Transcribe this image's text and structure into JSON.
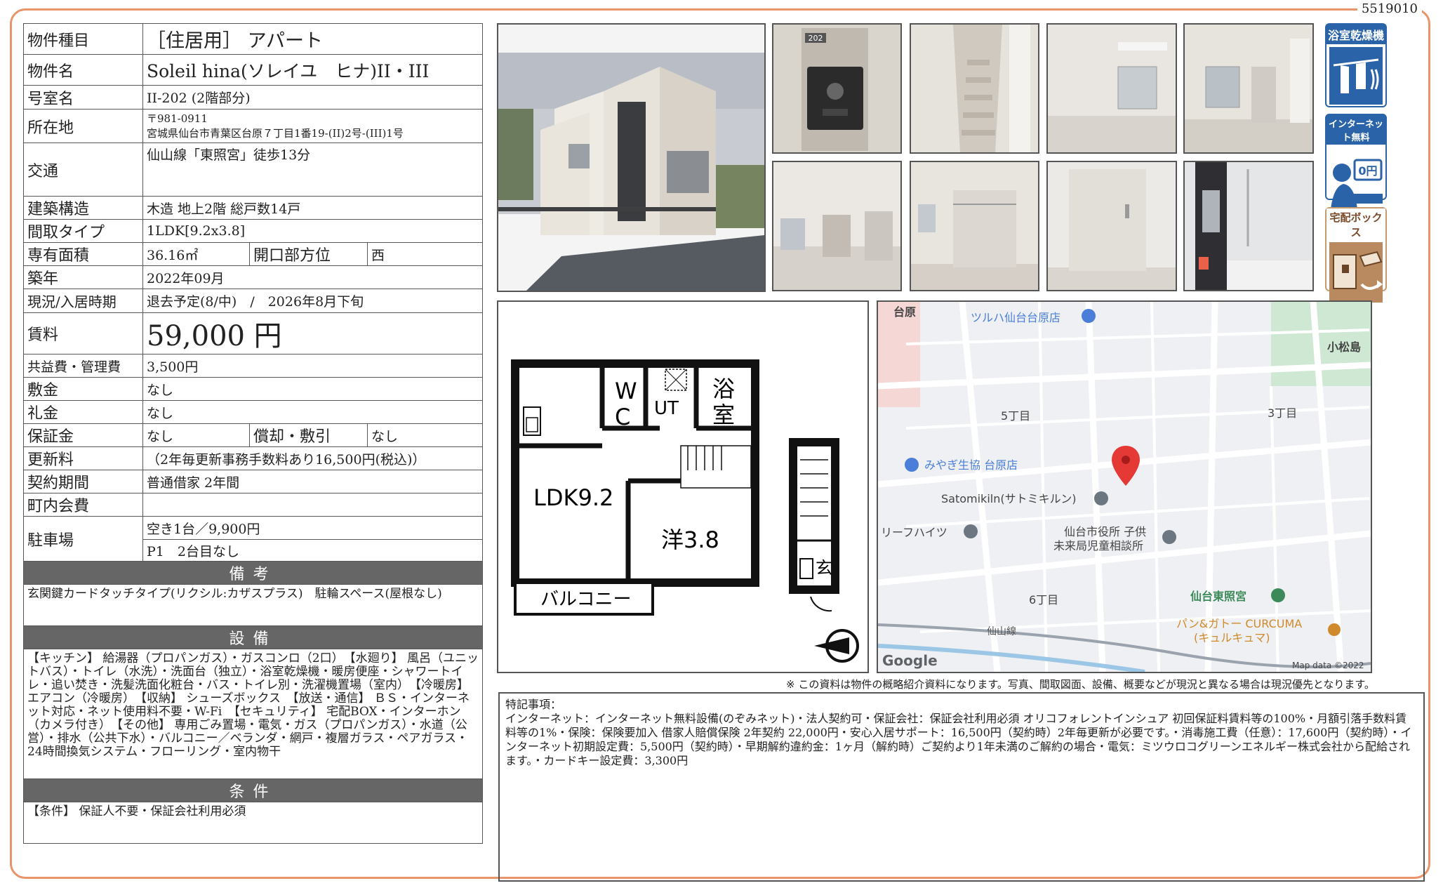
{
  "doc_id": "5519010",
  "spec": {
    "type_label": "物件種目",
    "type_value": "［住居用］ アパート",
    "name_label": "物件名",
    "name_value": "Soleil hina(ソレイユ　ヒナ)II・III",
    "room_label": "号室名",
    "room_value": "II-202 (2階部分)",
    "addr_label": "所在地",
    "addr_zip": "〒981-0911",
    "addr_value": "宮城県仙台市青葉区台原７丁目1番19-(II)2号-(III)1号",
    "access_label": "交通",
    "access_value": "仙山線「東照宮」徒歩13分",
    "struct_label": "建築構造",
    "struct_value": "木造 地上2階 総戸数14戸",
    "layout_label": "間取タイプ",
    "layout_value": "1LDK[9.2x3.8]",
    "area_label": "専有面積",
    "area_value": "36.16㎡",
    "facing_label": "開口部方位",
    "facing_value": "西",
    "built_label": "築年",
    "built_value": "2022年09月",
    "status_label": "現況/入居時期",
    "status_value": "退去予定(8/中)　/　2026年8月下旬",
    "rent_label": "賃料",
    "rent_value": "59,000 円",
    "fee_label": "共益費・管理費",
    "fee_value": "3,500円",
    "deposit_label": "敷金",
    "deposit_value": "なし",
    "key_label": "礼金",
    "key_value": "なし",
    "guarantee_label": "保証金",
    "guarantee_value": "なし",
    "amort_label": "償却・敷引",
    "amort_value": "なし",
    "renew_label": "更新料",
    "renew_value": "（2年毎更新事務手数料あり16,500円(税込)）",
    "contract_label": "契約期間",
    "contract_value": "普通借家 2年間",
    "town_label": "町内会費",
    "town_value": "",
    "parking_label": "駐車場",
    "parking_value1": "空き1台／9,900円",
    "parking_value2": "P1　2台目なし",
    "remarks_header": "備考",
    "remarks": "玄関鍵カードタッチタイプ(リクシル:カザスプラス)　駐輪スペース(屋根なし)",
    "equip_header": "設備",
    "equip": "【キッチン】 給湯器（プロパンガス）・ガスコンロ（2口）　【水廻り】 風呂（ユニットバス）・トイレ（水洗）・洗面台（独立）・浴室乾燥機・暖房便座・シャワートイレ・追い焚き・洗髪洗面化粧台・バス・トイレ別・洗濯機置場（室内）　【冷暖房】 エアコン（冷暖房）　【収納】 シューズボックス　【放送・通信】 ＢＳ・インターネット対応・ネット使用料不要・W-Fi　【セキュリティ】 宅配BOX・インターホン（カメラ付き）　【その他】 専用ごみ置場・電気・ガス（プロパンガス）・水道（公営）・排水（公共下水）・バルコニー／ベランダ・網戸・複層ガラス・ペアガラス・24時間換気システム・フローリング・室内物干",
    "cond_header": "条件",
    "cond": "【条件】 保証人不要・保証会社利用必須"
  },
  "badges": {
    "dryer": "浴室乾燥機",
    "internet": "インターネット無料",
    "internet_sub": "0円",
    "delivery": "宅配ボックス"
  },
  "photos": {
    "door_number": "202"
  },
  "floorplan": {
    "wc": "W\nC",
    "ut": "UT",
    "bath1": "浴",
    "bath2": "室",
    "ldk": "LDK9.2",
    "western": "洋3.8",
    "balcony": "バルコニー",
    "entrance": "玄"
  },
  "map": {
    "labels": {
      "dainohara": "台原",
      "tsuruha": "ツルハ仙台台原店",
      "c5": "5丁目",
      "komatsushima": "小松島",
      "c3": "3丁目",
      "miyagi": "みやぎ生協 台原店",
      "satomi": "Satomikiln(サトミキルン)",
      "leaf": "リーフハイツ",
      "city1": "仙台市役所 子供",
      "city2": "未来局児童相談所",
      "toshogu": "仙台東照宮",
      "c6": "6丁目",
      "senzan": "仙山線",
      "bakery1": "パン&ガトー CURCUMA",
      "bakery2": "(キュルキュマ)",
      "google": "Google",
      "mapdata": "Map data ©2022"
    }
  },
  "note": "※ この資料は物件の概略紹介資料になります。写真、間取図面、設備、概要などが現況と異なる場合は現況優先となります。",
  "memo_title": "特記事項：",
  "memo": "インターネット：インターネット無料設備(のぞみネット)・法人契約可・保証会社：保証会社利用必須 オリコフォレントインシュア 初回保証料賃料等の100%・月額引落手数料賃料等の1%・保険：保険要加入 借家人賠償保険 2年契約 22,000円・安心入居サポート：16,500円（契約時）2年毎更新が必要です。・消毒施工費（任意）：17,600円（契約時）・インターネット初期設定費：5,500円（契約時）・早期解約違約金：1ヶ月（解約時）ご契約より1年未満のご解約の場合・電気：ミツウロコグリーンエネルギー株式会社から配給されます。・カードキー設定費：3,300円"
}
